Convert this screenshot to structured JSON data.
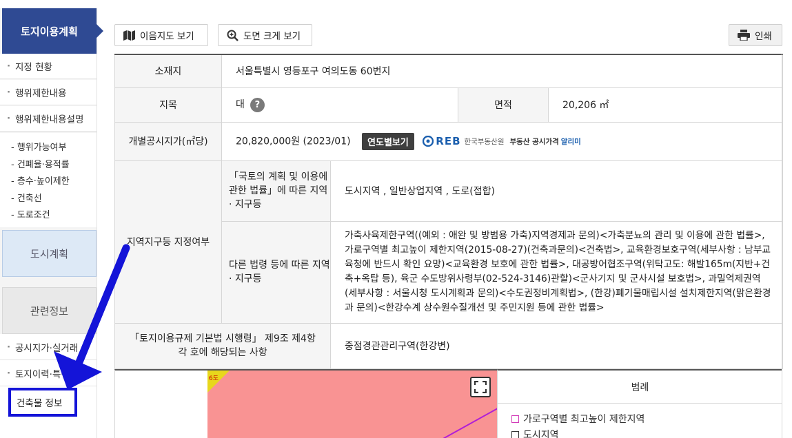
{
  "sidebar": {
    "title": "토지이용계획",
    "items": [
      {
        "label": "지정 현황"
      },
      {
        "label": "행위제한내용"
      },
      {
        "label": "행위제한내용설명"
      }
    ],
    "subitems": [
      {
        "label": "- 행위가능여부"
      },
      {
        "label": "- 건폐율·용적률"
      },
      {
        "label": "- 층수·높이제한"
      },
      {
        "label": "- 건축선"
      },
      {
        "label": "- 도로조건"
      }
    ],
    "city_plan": "도시계획",
    "related_info": "관련정보",
    "related_items": [
      {
        "label": "공시지가·실거래"
      },
      {
        "label": "토지이력·특성"
      }
    ],
    "building_info": "건축물 정보"
  },
  "toolbar": {
    "map_label": "이음지도 보기",
    "zoom_label": "도면 크게 보기",
    "print_label": "인쇄"
  },
  "table": {
    "location_label": "소재지",
    "location_value": "서울특별시 영등포구 여의도동 60번지",
    "land_category_label": "지목",
    "land_category_value": "대",
    "help_glyph": "?",
    "area_label": "면적",
    "area_value": "20,206 ㎡",
    "price_label": "개별공시지가(㎡당)",
    "price_value": "20,820,000원 (2023/01)",
    "yearly_button": "연도별보기",
    "reb_mark": "REB",
    "reb_org": "한국부동산원",
    "reb_service": "부동산 공시가격",
    "reb_alert": "알리미",
    "zoning_label": "지역지구등 지정여부",
    "national_law_label": "「국토의 계획 및 이용에 관한 법률」에 따른 지역 · 지구등",
    "national_law_value": "도시지역 , 일반상업지역 , 도로(접합)",
    "other_law_label": "다른 법령 등에 따른 지역 · 지구등",
    "other_law_value": "가축사육제한구역((예외 : 애완 및 방범용 가축)지역경제과 문의)<가축분뇨의 관리 및 이용에 관한 법률>, 가로구역별 최고높이 제한지역(2015-08-27)(건축과문의)<건축법>, 교육환경보호구역(세부사항 : 남부교육청에 반드시 확인 요망)<교육환경 보호에 관한 법률>, 대공방어협조구역(위탁고도: 해발165m(지반+건축+옥탑 등), 육군 수도방위사령부(02-524-3146)관할)<군사기지 및 군사시설 보호법>, 과밀억제권역(세부사항 : 서울시청 도시계획과 문의)<수도권정비계획법>, (한강)폐기물매립시설 설치제한지역(맑은환경과 문의)<한강수계 상수원수질개선 및 주민지원 등에 관한 법률>",
    "framework_label": "「토지이용규제 기본법 시행령」 제9조 제4항 각 호에 해당되는 사항",
    "framework_value": "중점경관관리구역(한강변)"
  },
  "map": {
    "label_text": "6도"
  },
  "legend": {
    "title": "범례",
    "items": [
      {
        "label": "가로구역별 최고높이 제한지역",
        "color": "#d23ab8"
      },
      {
        "label": "도시지역",
        "color": "#333333"
      }
    ]
  },
  "colors": {
    "sidebar_title": "#2f4a93",
    "annotation": "#1414d8",
    "map_fill": "#f99393"
  }
}
